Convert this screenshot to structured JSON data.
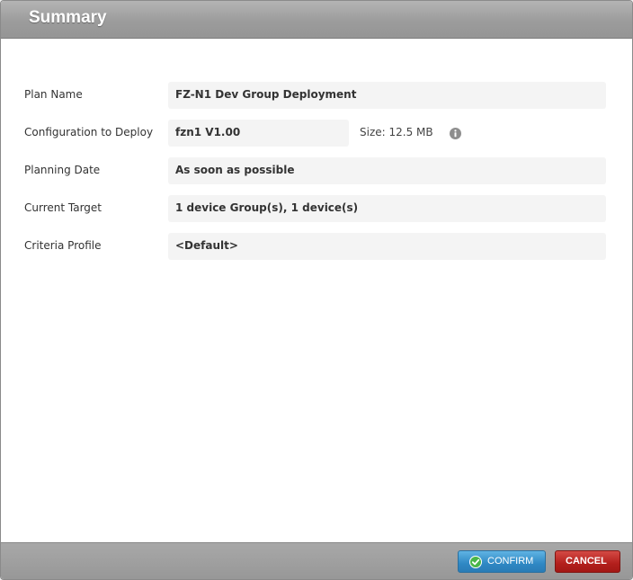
{
  "dialog": {
    "title": "Summary"
  },
  "summary": {
    "plan_name": {
      "label": "Plan Name",
      "value": "FZ-N1 Dev Group Deployment"
    },
    "configuration": {
      "label": "Configuration to Deploy",
      "value": "fzn1 V1.00",
      "size": "Size: 12.5 MB",
      "icon": "info-icon"
    },
    "planning_date": {
      "label": "Planning Date",
      "value": "As soon as possible"
    },
    "current_target": {
      "label": "Current Target",
      "value": "1 device Group(s), 1 device(s)"
    },
    "criteria_profile": {
      "label": "Criteria Profile",
      "value": "<Default>"
    }
  },
  "footer": {
    "confirm_label": "CONFIRM",
    "cancel_label": "CANCEL",
    "confirm_icon": "check-icon"
  },
  "colors": {
    "confirm_button": "#2f88c4",
    "cancel_button": "#b31f1c",
    "titlebar": "#9c9c9c"
  }
}
